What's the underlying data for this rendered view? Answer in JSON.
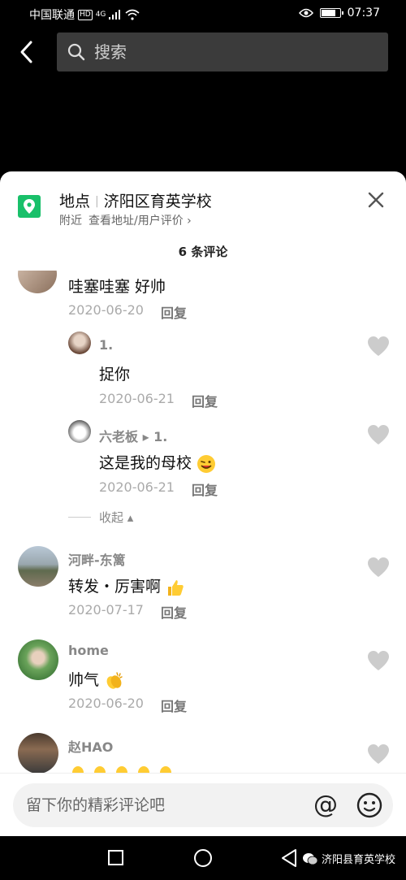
{
  "status_bar": {
    "carrier": "中国联通",
    "hd": "HD",
    "network": "4G",
    "time": "07:37",
    "battery_level": 0.85
  },
  "search": {
    "placeholder": "搜索"
  },
  "location": {
    "label": "地点",
    "name": "济阳区育英学校",
    "nearby": "附近",
    "link": "查看地址/用户评价 ›"
  },
  "comment_count": "6 条评论",
  "comments": [
    {
      "text": "哇塞哇塞 好帅",
      "date": "2020-06-20",
      "reply": "回复"
    },
    {
      "name": "1.",
      "text": "捉你",
      "date": "2020-06-21",
      "reply": "回复"
    },
    {
      "name": "六老板 ▸ 1.",
      "text": "这是我的母校",
      "date": "2020-06-21",
      "reply": "回复"
    },
    {
      "name": "河畔-东篱",
      "text": "转发・厉害啊",
      "date": "2020-07-17",
      "reply": "回复"
    },
    {
      "name": "home",
      "text": "帅气",
      "date": "2020-06-20",
      "reply": "回复"
    },
    {
      "name": "赵HAO"
    }
  ],
  "collapse": "收起 ▴",
  "input": {
    "placeholder": "留下你的精彩评论吧",
    "at": "@"
  },
  "watermark": "济阳县育英学校",
  "colors": {
    "accent_green": "#19c06a",
    "heart": "#cccccc"
  }
}
